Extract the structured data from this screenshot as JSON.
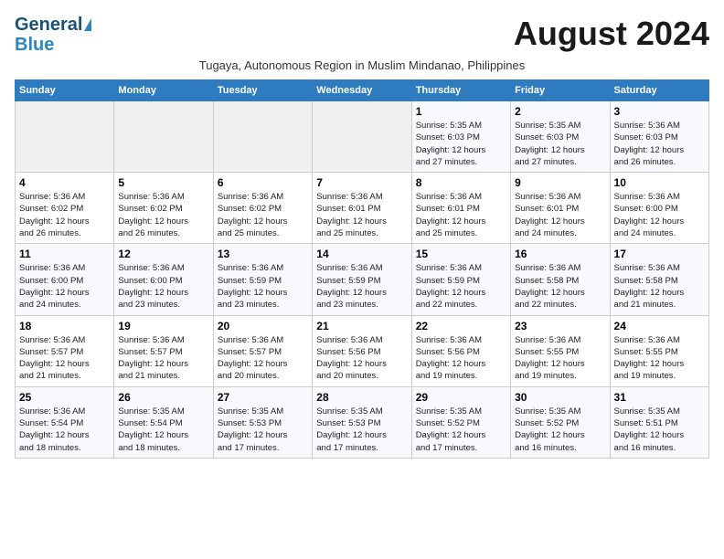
{
  "header": {
    "logo_line1": "General",
    "logo_line2": "Blue",
    "month_title": "August 2024",
    "subtitle": "Tugaya, Autonomous Region in Muslim Mindanao, Philippines"
  },
  "weekdays": [
    "Sunday",
    "Monday",
    "Tuesday",
    "Wednesday",
    "Thursday",
    "Friday",
    "Saturday"
  ],
  "weeks": [
    [
      {
        "day": "",
        "info": ""
      },
      {
        "day": "",
        "info": ""
      },
      {
        "day": "",
        "info": ""
      },
      {
        "day": "",
        "info": ""
      },
      {
        "day": "1",
        "info": "Sunrise: 5:35 AM\nSunset: 6:03 PM\nDaylight: 12 hours\nand 27 minutes."
      },
      {
        "day": "2",
        "info": "Sunrise: 5:35 AM\nSunset: 6:03 PM\nDaylight: 12 hours\nand 27 minutes."
      },
      {
        "day": "3",
        "info": "Sunrise: 5:36 AM\nSunset: 6:03 PM\nDaylight: 12 hours\nand 26 minutes."
      }
    ],
    [
      {
        "day": "4",
        "info": "Sunrise: 5:36 AM\nSunset: 6:02 PM\nDaylight: 12 hours\nand 26 minutes."
      },
      {
        "day": "5",
        "info": "Sunrise: 5:36 AM\nSunset: 6:02 PM\nDaylight: 12 hours\nand 26 minutes."
      },
      {
        "day": "6",
        "info": "Sunrise: 5:36 AM\nSunset: 6:02 PM\nDaylight: 12 hours\nand 25 minutes."
      },
      {
        "day": "7",
        "info": "Sunrise: 5:36 AM\nSunset: 6:01 PM\nDaylight: 12 hours\nand 25 minutes."
      },
      {
        "day": "8",
        "info": "Sunrise: 5:36 AM\nSunset: 6:01 PM\nDaylight: 12 hours\nand 25 minutes."
      },
      {
        "day": "9",
        "info": "Sunrise: 5:36 AM\nSunset: 6:01 PM\nDaylight: 12 hours\nand 24 minutes."
      },
      {
        "day": "10",
        "info": "Sunrise: 5:36 AM\nSunset: 6:00 PM\nDaylight: 12 hours\nand 24 minutes."
      }
    ],
    [
      {
        "day": "11",
        "info": "Sunrise: 5:36 AM\nSunset: 6:00 PM\nDaylight: 12 hours\nand 24 minutes."
      },
      {
        "day": "12",
        "info": "Sunrise: 5:36 AM\nSunset: 6:00 PM\nDaylight: 12 hours\nand 23 minutes."
      },
      {
        "day": "13",
        "info": "Sunrise: 5:36 AM\nSunset: 5:59 PM\nDaylight: 12 hours\nand 23 minutes."
      },
      {
        "day": "14",
        "info": "Sunrise: 5:36 AM\nSunset: 5:59 PM\nDaylight: 12 hours\nand 23 minutes."
      },
      {
        "day": "15",
        "info": "Sunrise: 5:36 AM\nSunset: 5:59 PM\nDaylight: 12 hours\nand 22 minutes."
      },
      {
        "day": "16",
        "info": "Sunrise: 5:36 AM\nSunset: 5:58 PM\nDaylight: 12 hours\nand 22 minutes."
      },
      {
        "day": "17",
        "info": "Sunrise: 5:36 AM\nSunset: 5:58 PM\nDaylight: 12 hours\nand 21 minutes."
      }
    ],
    [
      {
        "day": "18",
        "info": "Sunrise: 5:36 AM\nSunset: 5:57 PM\nDaylight: 12 hours\nand 21 minutes."
      },
      {
        "day": "19",
        "info": "Sunrise: 5:36 AM\nSunset: 5:57 PM\nDaylight: 12 hours\nand 21 minutes."
      },
      {
        "day": "20",
        "info": "Sunrise: 5:36 AM\nSunset: 5:57 PM\nDaylight: 12 hours\nand 20 minutes."
      },
      {
        "day": "21",
        "info": "Sunrise: 5:36 AM\nSunset: 5:56 PM\nDaylight: 12 hours\nand 20 minutes."
      },
      {
        "day": "22",
        "info": "Sunrise: 5:36 AM\nSunset: 5:56 PM\nDaylight: 12 hours\nand 19 minutes."
      },
      {
        "day": "23",
        "info": "Sunrise: 5:36 AM\nSunset: 5:55 PM\nDaylight: 12 hours\nand 19 minutes."
      },
      {
        "day": "24",
        "info": "Sunrise: 5:36 AM\nSunset: 5:55 PM\nDaylight: 12 hours\nand 19 minutes."
      }
    ],
    [
      {
        "day": "25",
        "info": "Sunrise: 5:36 AM\nSunset: 5:54 PM\nDaylight: 12 hours\nand 18 minutes."
      },
      {
        "day": "26",
        "info": "Sunrise: 5:35 AM\nSunset: 5:54 PM\nDaylight: 12 hours\nand 18 minutes."
      },
      {
        "day": "27",
        "info": "Sunrise: 5:35 AM\nSunset: 5:53 PM\nDaylight: 12 hours\nand 17 minutes."
      },
      {
        "day": "28",
        "info": "Sunrise: 5:35 AM\nSunset: 5:53 PM\nDaylight: 12 hours\nand 17 minutes."
      },
      {
        "day": "29",
        "info": "Sunrise: 5:35 AM\nSunset: 5:52 PM\nDaylight: 12 hours\nand 17 minutes."
      },
      {
        "day": "30",
        "info": "Sunrise: 5:35 AM\nSunset: 5:52 PM\nDaylight: 12 hours\nand 16 minutes."
      },
      {
        "day": "31",
        "info": "Sunrise: 5:35 AM\nSunset: 5:51 PM\nDaylight: 12 hours\nand 16 minutes."
      }
    ]
  ]
}
